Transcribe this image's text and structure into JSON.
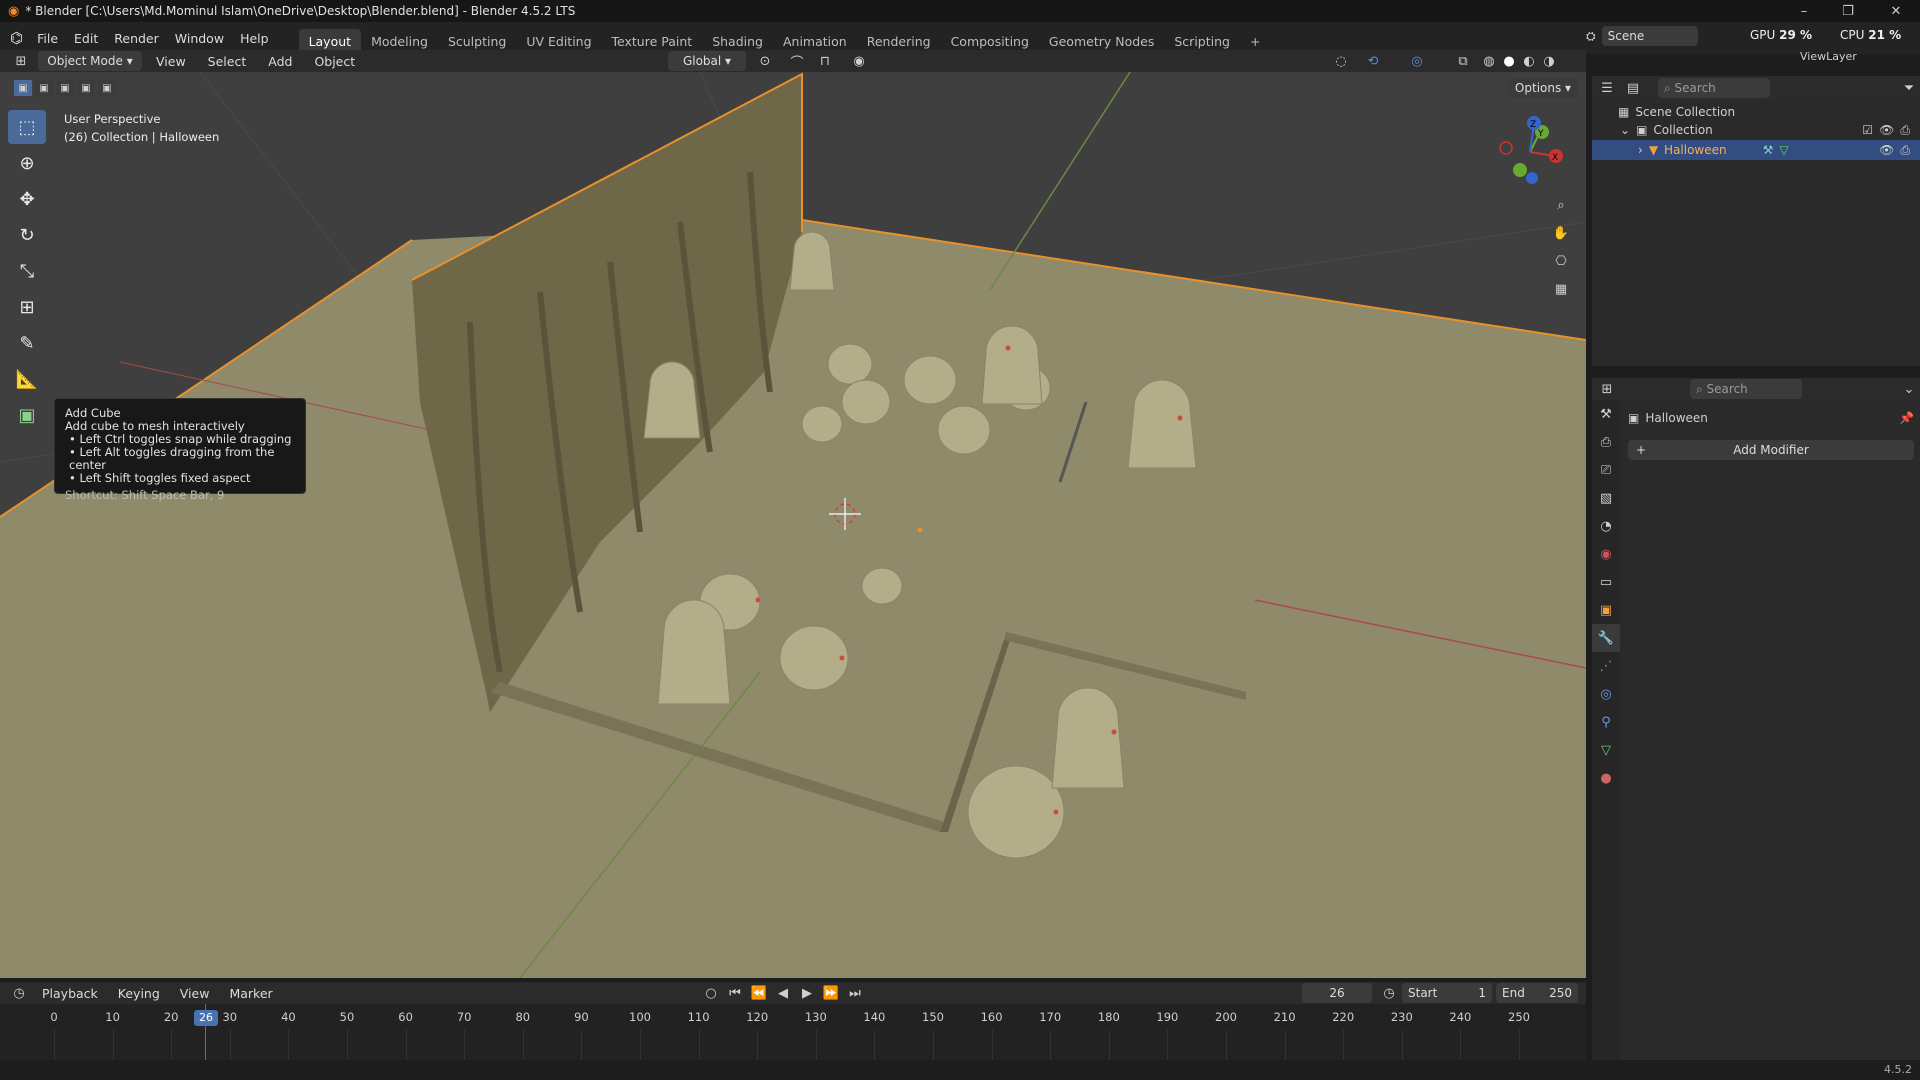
{
  "window": {
    "title": "* Blender [C:\\Users\\Md.Mominul Islam\\OneDrive\\Desktop\\Blender.blend] - Blender 4.5.2 LTS",
    "minimize": "–",
    "maximize": "❐",
    "close": "✕"
  },
  "menu": {
    "items": [
      "File",
      "Edit",
      "Render",
      "Window",
      "Help"
    ]
  },
  "workspaces": [
    "Layout",
    "Modeling",
    "Sculpting",
    "UV Editing",
    "Texture Paint",
    "Shading",
    "Animation",
    "Rendering",
    "Compositing",
    "Geometry Nodes",
    "Scripting"
  ],
  "workspace_add": "+",
  "scene": {
    "name": "Scene",
    "view_layer": "ViewLayer"
  },
  "perf": {
    "gpu_label": "GPU",
    "gpu_value": "29 %",
    "cpu_label": "CPU",
    "cpu_value": "21 %"
  },
  "viewport_header": {
    "mode": "Object Mode",
    "menus": [
      "View",
      "Select",
      "Add",
      "Object"
    ],
    "orientation": "Global",
    "options": "Options"
  },
  "viewport": {
    "perspective": "User Perspective",
    "collection_info": "(26) Collection | Halloween"
  },
  "gizmo": {
    "x": "X",
    "y": "Y",
    "z": "Z"
  },
  "tooltip": {
    "title": "Add Cube",
    "desc": "Add cube to mesh interactively",
    "lines": [
      "• Left Ctrl toggles snap while dragging",
      "• Left Alt toggles dragging from the center",
      "• Left Shift toggles fixed aspect"
    ],
    "shortcut": "Shortcut: Shift Space Bar, 9"
  },
  "outliner": {
    "search_placeholder": "Search",
    "scene_collection": "Scene Collection",
    "collection": "Collection",
    "object": "Halloween"
  },
  "properties": {
    "search_placeholder": "Search",
    "object": "Halloween",
    "add_modifier": "Add Modifier"
  },
  "timeline": {
    "menus": [
      "Playback",
      "Keying",
      "View",
      "Marker"
    ],
    "current_frame": "26",
    "start_label": "Start",
    "start": "1",
    "end_label": "End",
    "end": "250",
    "ticks": [
      "0",
      "10",
      "20",
      "30",
      "40",
      "50",
      "60",
      "70",
      "80",
      "90",
      "100",
      "110",
      "120",
      "130",
      "140",
      "150",
      "160",
      "170",
      "180",
      "190",
      "200",
      "210",
      "220",
      "230",
      "240",
      "250"
    ]
  },
  "statusbar": {
    "version": "4.5.2"
  },
  "colors": {
    "accent": "#4772b3",
    "selection": "#ffa030",
    "ground": "#8f8a6a"
  }
}
